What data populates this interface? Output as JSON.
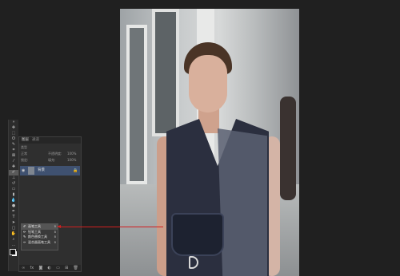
{
  "layers_panel": {
    "tabs": [
      "图层",
      "通道"
    ],
    "kind_filter": "类型",
    "blend_mode": "正常",
    "opacity_label": "不透明度:",
    "opacity_value": "100%",
    "lock_label": "锁定:",
    "fill_label": "填充:",
    "fill_value": "100%",
    "layer": {
      "name": "背景",
      "lock_icon": "lock-icon",
      "visible": true
    }
  },
  "tool_flyout": {
    "items": [
      {
        "label": "画笔工具",
        "key": "B",
        "selected": true
      },
      {
        "label": "铅笔工具",
        "key": "B",
        "selected": false
      },
      {
        "label": "颜色替换工具",
        "key": "B",
        "selected": false
      },
      {
        "label": "混合器画笔工具",
        "key": "B",
        "selected": false
      }
    ]
  },
  "annotation": {
    "color": "#d21f1f"
  },
  "colors": {
    "foreground": "#111111",
    "background": "#ffffff",
    "layer_selected": "#3f5170"
  }
}
